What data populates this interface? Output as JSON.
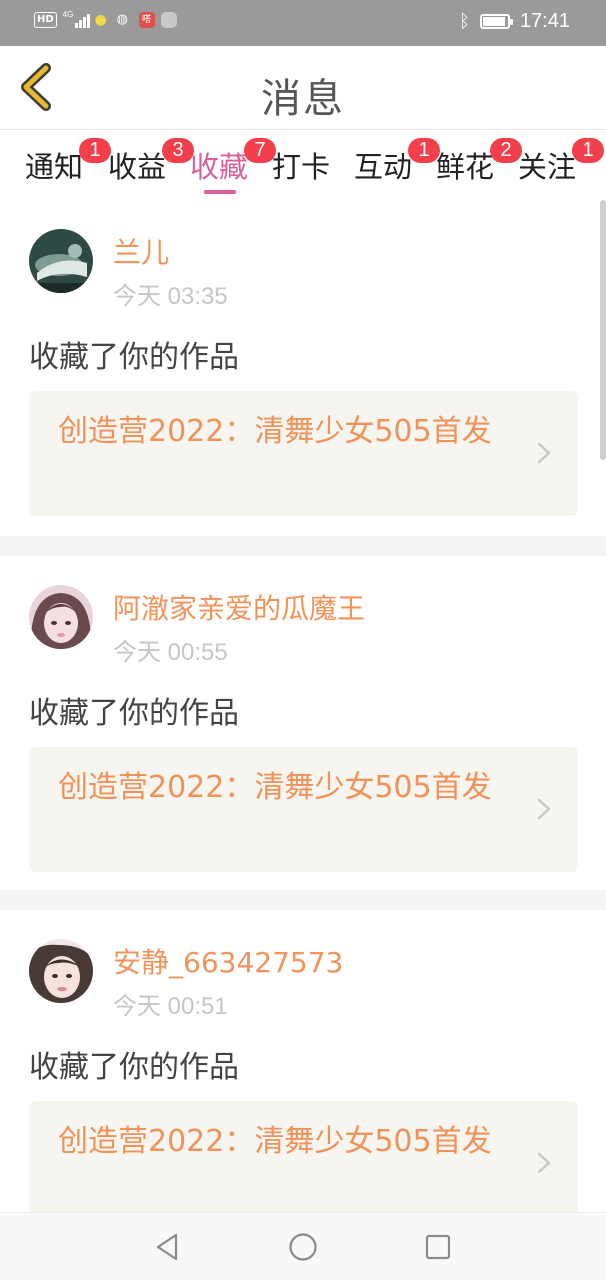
{
  "status_bar": {
    "left_badge": "HD",
    "network": "4G",
    "app_badge": "嗒",
    "time": "17:41"
  },
  "header": {
    "title": "消息"
  },
  "tabs": [
    {
      "label": "通知",
      "badge": "1",
      "active": false
    },
    {
      "label": "收益",
      "badge": "3",
      "active": false
    },
    {
      "label": "收藏",
      "badge": "7",
      "active": true
    },
    {
      "label": "打卡",
      "badge": "",
      "active": false
    },
    {
      "label": "互动",
      "badge": "1",
      "active": false
    },
    {
      "label": "鲜花",
      "badge": "2",
      "active": false
    },
    {
      "label": "关注",
      "badge": "1",
      "active": false
    }
  ],
  "feed": [
    {
      "user": "兰儿",
      "time": "今天 03:35",
      "action": "收藏了你的作品",
      "work": "创造营2022：清舞少女505首发"
    },
    {
      "user": "阿澈家亲爱的瓜魔王",
      "time": "今天 00:55",
      "action": "收藏了你的作品",
      "work": "创造营2022：清舞少女505首发"
    },
    {
      "user": "安静_663427573",
      "time": "今天 00:51",
      "action": "收藏了你的作品",
      "work": "创造营2022：清舞少女505首发"
    }
  ],
  "colors": {
    "accent_pink": "#d9609a",
    "name_orange": "#f2935a",
    "badge_red": "#f23f4b",
    "back_yellow": "#e7b92a"
  }
}
